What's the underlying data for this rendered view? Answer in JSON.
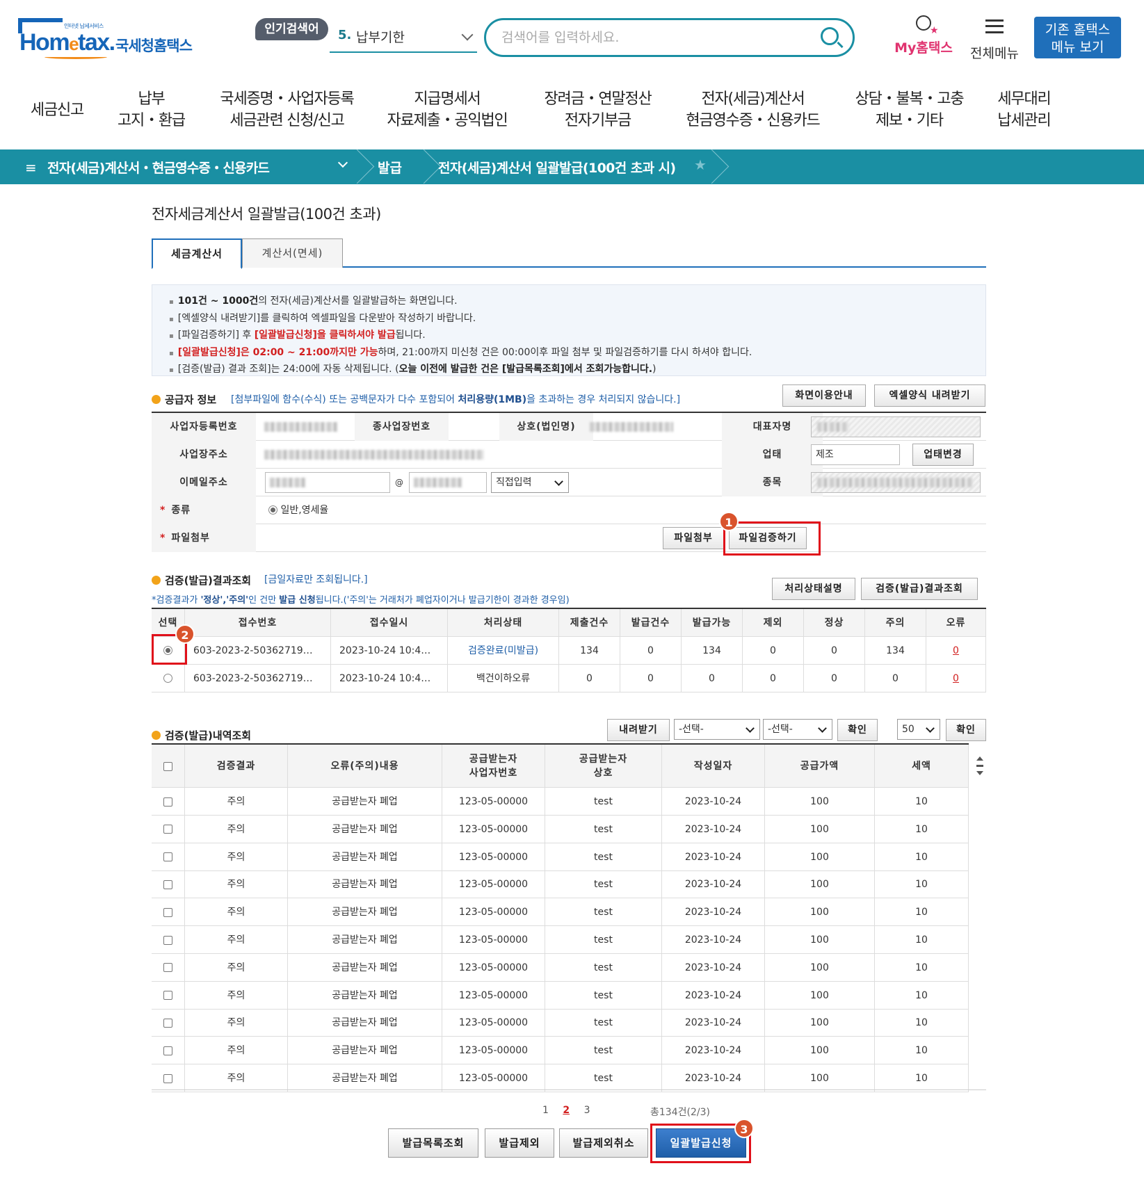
{
  "header": {
    "logo_small": "인터넷 납세서비스",
    "logo_word_a": "Hom",
    "logo_word_e": "e",
    "logo_word_b": "tax.",
    "logo_kr": "국세청홈택스",
    "popular_badge": "인기검색어",
    "popular_num": "5.",
    "popular_text": "납부기한",
    "search_placeholder": "검색어를 입력하세요.",
    "my_hometax": "My홈택스",
    "all_menu": "전체메뉴",
    "old_menu_line1": "기존 홈택스",
    "old_menu_line2": "메뉴 보기"
  },
  "gnb": [
    {
      "l1": "세금신고",
      "l2": ""
    },
    {
      "l1": "납부",
      "l2": "고지・환급"
    },
    {
      "l1": "국세증명・사업자등록",
      "l2": "세금관련 신청/신고"
    },
    {
      "l1": "지급명세서",
      "l2": "자료제출・공익법인"
    },
    {
      "l1": "장려금・연말정산",
      "l2": "전자기부금"
    },
    {
      "l1": "전자(세금)계산서",
      "l2": "현금영수증・신용카드"
    },
    {
      "l1": "상담・불복・고충",
      "l2": "제보・기타"
    },
    {
      "l1": "세무대리",
      "l2": "납세관리"
    }
  ],
  "breadcrumb": {
    "c1": "전자(세금)계산서・현금영수증・신용카드",
    "c2": "발급",
    "c3": "전자(세금)계산서 일괄발급(100건 초과 시)"
  },
  "page_title": "전자세금계산서 일괄발급(100건 초과)",
  "tabs": [
    "세금계산서",
    "계산서(면세)"
  ],
  "notice": {
    "l1_b": "101건 ~ 1000건",
    "l1": "의 전자(세금)계산서를 일괄발급하는 화면입니다.",
    "l2": "[엑셀양식 내려받기]를 클릭하여 엑셀파일을 다운받아 작성하기 바랍니다.",
    "l3_a": "[파일검증하기] 후 ",
    "l3_red": "[일괄발급신청]을 클릭하셔야 발급",
    "l3_b": "됩니다.",
    "l4_red": "[일괄발급신청]은 02:00 ~ 21:00까지만 가능",
    "l4": "하며, 21:00까지 미신청 건은 00:00이후 파일 첨부 및 파일검증하기를 다시 하셔야 합니다.",
    "l5_a": "[검증(발급) 결과 조회]는 24:00에 자동 삭제됩니다. (",
    "l5_b": "오늘 이전에 발급한 건은 [발급목록조회]에서 조회가능합니다.",
    "l5_c": ")"
  },
  "supplier": {
    "title": "공급자 정보",
    "note_a": "[첨부파일에 함수(수식) 또는 공백문자가 다수 포함되어 ",
    "note_b": "처리용량(1MB)",
    "note_c": "을 초과하는 경우 처리되지 않습니다.]",
    "btn_guide": "화면이용안내",
    "btn_excel": "엑셀양식 내려받기",
    "lbl_bizno": "사업자등록번호",
    "lbl_subno": "종사업장번호",
    "lbl_name": "상호(법인명)",
    "lbl_ceo": "대표자명",
    "lbl_addr": "사업장주소",
    "lbl_biztype": "업태",
    "biztype_val": "제조",
    "btn_biztype": "업태변경",
    "lbl_email": "이메일주소",
    "email_at": "@",
    "email_domain_select": "직접입력",
    "lbl_item": "종목",
    "lbl_kind": "종류",
    "kind_val": "일반,영세율",
    "lbl_file": "파일첨부",
    "btn_attach": "파일첨부",
    "btn_verify": "파일검증하기"
  },
  "result": {
    "title": "검증(발급)결과조회",
    "note": "[금일자료만 조회됩니다.]",
    "sub_a": "*검증결과가 ",
    "sub_b": "'정상','주의'",
    "sub_c": "인 건만 ",
    "sub_d": "발급 신청",
    "sub_e": "됩니다.('주의'는 거래처가 폐업자이거나 발급기한이 경과한 경우임)",
    "btn_status": "처리상태설명",
    "btn_result": "검증(발급)결과조회",
    "columns": [
      "선택",
      "접수번호",
      "접수일시",
      "처리상태",
      "제출건수",
      "발급건수",
      "발급가능",
      "제외",
      "정상",
      "주의",
      "오류"
    ],
    "rows": [
      {
        "no": "603-2023-2-50362719…",
        "dt": "2023-10-24 10:4…",
        "status": "검증완료(미발급)",
        "submit": "134",
        "issued": "0",
        "possible": "134",
        "excl": "0",
        "normal": "0",
        "warn": "134",
        "err": "0"
      },
      {
        "no": "603-2023-2-50362719…",
        "dt": "2023-10-24 10:4…",
        "status": "백건이하오류",
        "submit": "0",
        "issued": "0",
        "possible": "0",
        "excl": "0",
        "normal": "0",
        "warn": "0",
        "err": "0"
      }
    ]
  },
  "history": {
    "title": "검증(발급)내역조회",
    "btn_download": "내려받기",
    "select1": "-선택-",
    "select2": "-선택-",
    "btn_ok1": "확인",
    "page_size": "50",
    "btn_ok2": "확인",
    "columns": [
      "검증결과",
      "오류(주의)내용",
      "공급받는자 사업자번호",
      "공급받는자 상호",
      "작성일자",
      "공급가액",
      "세액"
    ],
    "col_bizno_l1": "공급받는자",
    "col_bizno_l2": "사업자번호",
    "col_name_l1": "공급받는자",
    "col_name_l2": "상호",
    "rows": [
      {
        "result": "주의",
        "msg": "공급받는자 폐업",
        "bizno": "123-05-00000",
        "name": "test",
        "date": "2023-10-24",
        "amt": "100",
        "tax": "10"
      },
      {
        "result": "주의",
        "msg": "공급받는자 폐업",
        "bizno": "123-05-00000",
        "name": "test",
        "date": "2023-10-24",
        "amt": "100",
        "tax": "10"
      },
      {
        "result": "주의",
        "msg": "공급받는자 폐업",
        "bizno": "123-05-00000",
        "name": "test",
        "date": "2023-10-24",
        "amt": "100",
        "tax": "10"
      },
      {
        "result": "주의",
        "msg": "공급받는자 폐업",
        "bizno": "123-05-00000",
        "name": "test",
        "date": "2023-10-24",
        "amt": "100",
        "tax": "10"
      },
      {
        "result": "주의",
        "msg": "공급받는자 폐업",
        "bizno": "123-05-00000",
        "name": "test",
        "date": "2023-10-24",
        "amt": "100",
        "tax": "10"
      },
      {
        "result": "주의",
        "msg": "공급받는자 폐업",
        "bizno": "123-05-00000",
        "name": "test",
        "date": "2023-10-24",
        "amt": "100",
        "tax": "10"
      },
      {
        "result": "주의",
        "msg": "공급받는자 폐업",
        "bizno": "123-05-00000",
        "name": "test",
        "date": "2023-10-24",
        "amt": "100",
        "tax": "10"
      },
      {
        "result": "주의",
        "msg": "공급받는자 폐업",
        "bizno": "123-05-00000",
        "name": "test",
        "date": "2023-10-24",
        "amt": "100",
        "tax": "10"
      },
      {
        "result": "주의",
        "msg": "공급받는자 폐업",
        "bizno": "123-05-00000",
        "name": "test",
        "date": "2023-10-24",
        "amt": "100",
        "tax": "10"
      },
      {
        "result": "주의",
        "msg": "공급받는자 폐업",
        "bizno": "123-05-00000",
        "name": "test",
        "date": "2023-10-24",
        "amt": "100",
        "tax": "10"
      },
      {
        "result": "주의",
        "msg": "공급받는자 폐업",
        "bizno": "123-05-00000",
        "name": "test",
        "date": "2023-10-24",
        "amt": "100",
        "tax": "10"
      }
    ],
    "pages": [
      "1",
      "2",
      "3"
    ],
    "current_page": "2",
    "total": "총134건(2/3)"
  },
  "bottom_buttons": {
    "list": "발급목록조회",
    "exclude": "발급제외",
    "cancel_exclude": "발급제외취소",
    "apply": "일괄발급신청"
  },
  "markers": [
    "1",
    "2",
    "3"
  ],
  "colors": {
    "teal": "#1a8fa3",
    "blue": "#1f6fba",
    "accent_red": "#e0101a",
    "marker": "#d9532c"
  }
}
